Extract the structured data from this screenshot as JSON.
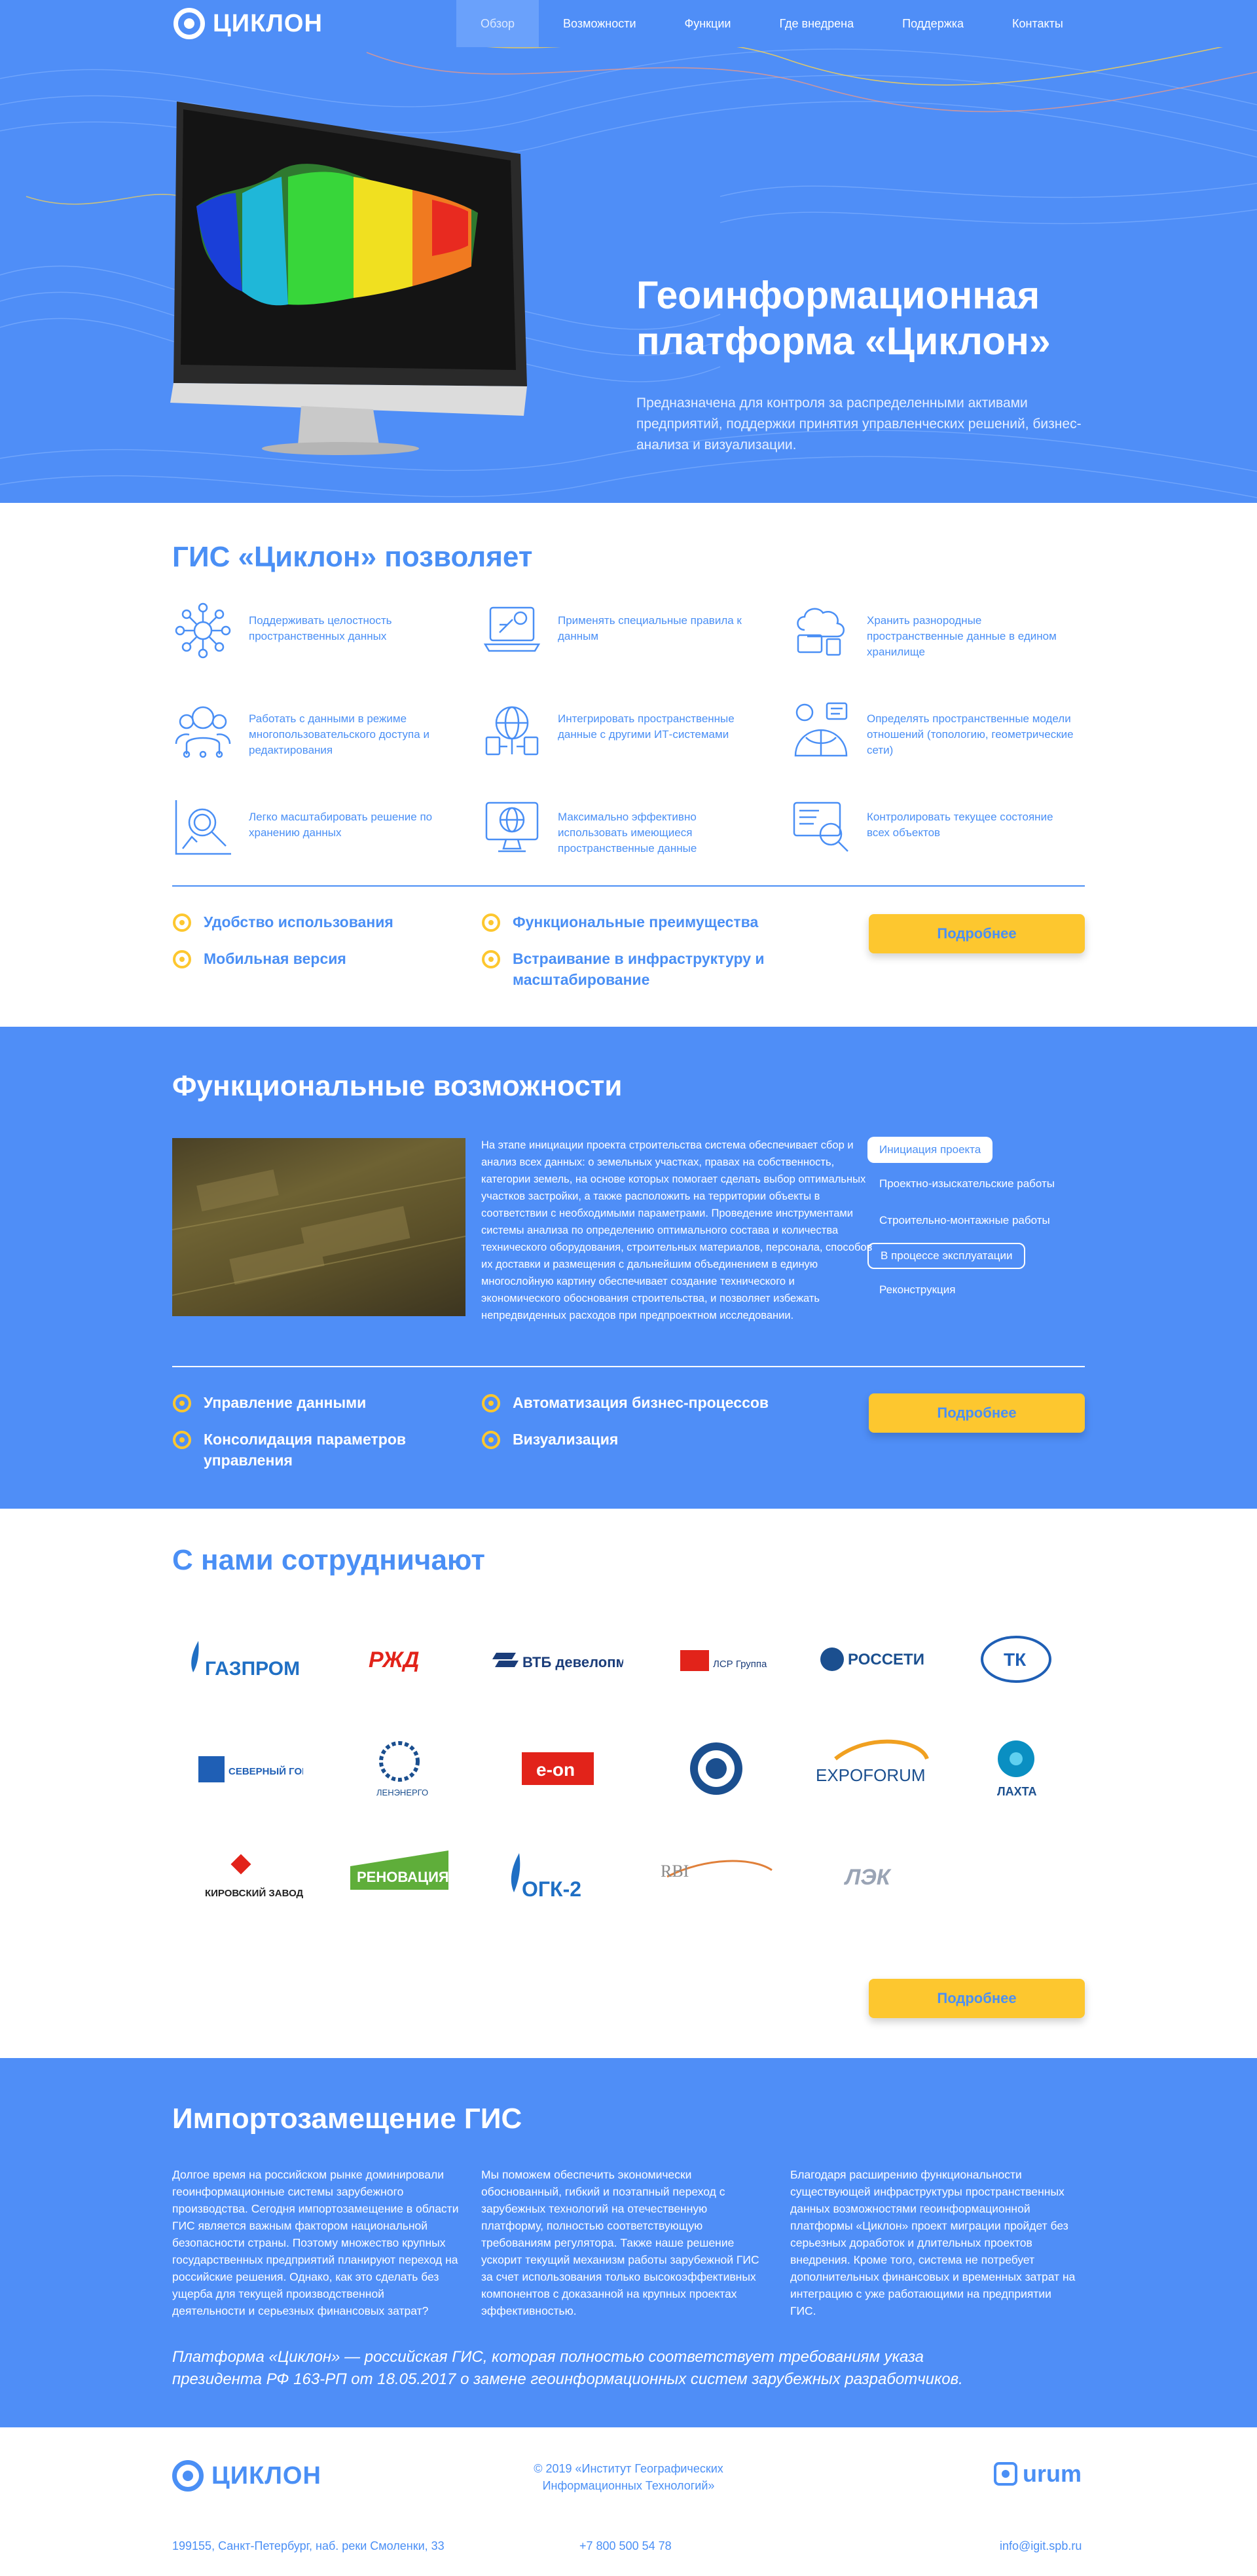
{
  "brand": {
    "name": "ЦИКЛОН",
    "accent": "#4f8ef7",
    "button": "#fdc72f"
  },
  "nav": {
    "items": [
      "Обзор",
      "Возможности",
      "Функции",
      "Где внедрена",
      "Поддержка",
      "Контакты"
    ],
    "active": "Обзор"
  },
  "hero": {
    "title": "Геоинформационная платформа «Циклон»",
    "subtitle": "Предназначена для контроля за распределенными активами предприятий, поддержки принятия управленческих решений, бизнес-анализа и визуализации."
  },
  "allows": {
    "title": "ГИС «Циклон» позволяет",
    "features": [
      {
        "icon": "network-icon",
        "text": "Поддерживать целостность пространственных данных"
      },
      {
        "icon": "laptop-rules-icon",
        "text": "Применять специальные правила к данным"
      },
      {
        "icon": "cloud-storage-icon",
        "text": "Хранить разнородные пространственные данные в едином хранилище"
      },
      {
        "icon": "users-icon",
        "text": "Работать с данными в режиме многопользовательского доступа и редактирования"
      },
      {
        "icon": "globe-integration-icon",
        "text": "Интегрировать пространственные данные с другими ИТ-системами"
      },
      {
        "icon": "globe-model-icon",
        "text": "Определять пространственные модели отношений (топологию, геометрические сети)"
      },
      {
        "icon": "chart-scale-icon",
        "text": "Легко масштабировать решение по хранению данных"
      },
      {
        "icon": "monitor-globe-icon",
        "text": "Максимально эффективно использовать имеющиеся пространственные данные"
      },
      {
        "icon": "monitor-search-icon",
        "text": "Контролировать текущее состояние всех объектов"
      }
    ],
    "bullets": [
      "Удобство использования",
      "Функциональные преимущества",
      "Мобильная версия",
      "Встраивание в инфраструктуру и масштабирование"
    ],
    "button": "Подробнее"
  },
  "functional": {
    "title": "Функциональные возможности",
    "text": "На этапе инициации проекта строительства система обеспечивает сбор и анализ всех данных: о земельных участках, правах на собственность, категории земель, на основе которых помогает сделать выбор оптимальных участков застройки, а также расположить на территории объекты в соответствии с необходимыми параметрами. Проведение инструментами системы анализа по определению оптимального состава и количества технического оборудования, строительных материалов, персонала, способов их доставки и размещения с дальнейшим объединением в единую многослойную картину обеспечивает создание технического и экономического обоснования строительства, и позволяет избежать непредвиденных расходов при предпроектном исследовании.",
    "stages": [
      "Инициация проекта",
      "Проектно-изыскательские работы",
      "Строительно-монтажные работы",
      "В процессе эксплуатации",
      "Реконструкция"
    ],
    "stage_selected": "Инициация проекта",
    "stage_outlined": "В процессе эксплуатации",
    "bullets": [
      "Управление данными",
      "Автоматизация бизнес-процессов",
      "Консолидация параметров управления",
      "Визуализация"
    ],
    "button": "Подробнее"
  },
  "partners": {
    "title": "С нами сотрудничают",
    "logos": [
      {
        "name": "ГАЗПРОМ",
        "color": "#1f6fc4"
      },
      {
        "name": "РЖД",
        "color": "#e2231a"
      },
      {
        "name": "ВТБ девелопмент",
        "color": "#1b3d7a"
      },
      {
        "name": "ЛСР Группа",
        "color": "#e2231a"
      },
      {
        "name": "РОССЕТИ",
        "color": "#1b4f8f"
      },
      {
        "name": "ТК",
        "color": "#1f5fb5"
      },
      {
        "name": "СЕВЕРНЫЙ ГОРОД",
        "color": "#1f5fb5"
      },
      {
        "name": "ЛЕНЭНЕРГО",
        "color": "#1b4f8f"
      },
      {
        "name": "e-on",
        "color": "#e2231a"
      },
      {
        "name": "эмблема",
        "color": "#1b4f8f"
      },
      {
        "name": "EXPOFORUM",
        "color": "#1b4f8f"
      },
      {
        "name": "ЛАХТА",
        "color": "#0a8fc2"
      },
      {
        "name": "КИРОВСКИЙ ЗАВОД",
        "color": "#e2231a"
      },
      {
        "name": "РЕНОВАЦИЯ",
        "color": "#5fae3a"
      },
      {
        "name": "ОГК-2",
        "color": "#1f6fc4"
      },
      {
        "name": "RBI",
        "color": "#8a8a8a"
      },
      {
        "name": "ЛЭК",
        "color": "#9aa4b5"
      }
    ],
    "button": "Подробнее"
  },
  "import": {
    "title": "Импортозамещение ГИС",
    "columns": [
      "Долгое время на российском рынке доминировали геоинформационные системы зарубежного производства. Сегодня импортозамещение в области ГИС является важным фактором национальной безопасности страны. Поэтому множество крупных государственных предприятий планируют переход на российские решения. Однако, как это сделать без ущерба для текущей производственной деятельности и серьезных финансовых затрат?",
      "Мы поможем обеспечить экономически обоснованный, гибкий и поэтапный переход с зарубежных технологий на отечественную платформу, полностью соответствующую требованиям регулятора. Также наше решение ускорит текущий механизм работы зарубежной ГИС за счет использования только высокоэффективных компонентов с доказанной на крупных проектах эффективностью.",
      "Благодаря расширению функциональности существующей инфраструктуры пространственных данных возможностями геоинформационной платформы «Циклон» проект миграции пройдет без серьезных доработок и длительных проектов внедрения. Кроме того, система не потребует дополнительных финансовых и временных затрат на интеграцию с уже работающими на предприятии ГИС."
    ],
    "quote": "Платформа «Циклон» — российская ГИС, которая полностью соответствует требованиям указа президента РФ 163-РП от 18.05.2017 о замене геоинформационных систем зарубежных разработчиков."
  },
  "footer": {
    "copyright": "© 2019 «Институт Географических Информационных Технологий»",
    "partner_logo": "urum",
    "address": "199155, Санкт-Петербург, наб. реки Смоленки, 33",
    "phone": "+7 800 500 54 78",
    "email": "info@igit.spb.ru"
  }
}
